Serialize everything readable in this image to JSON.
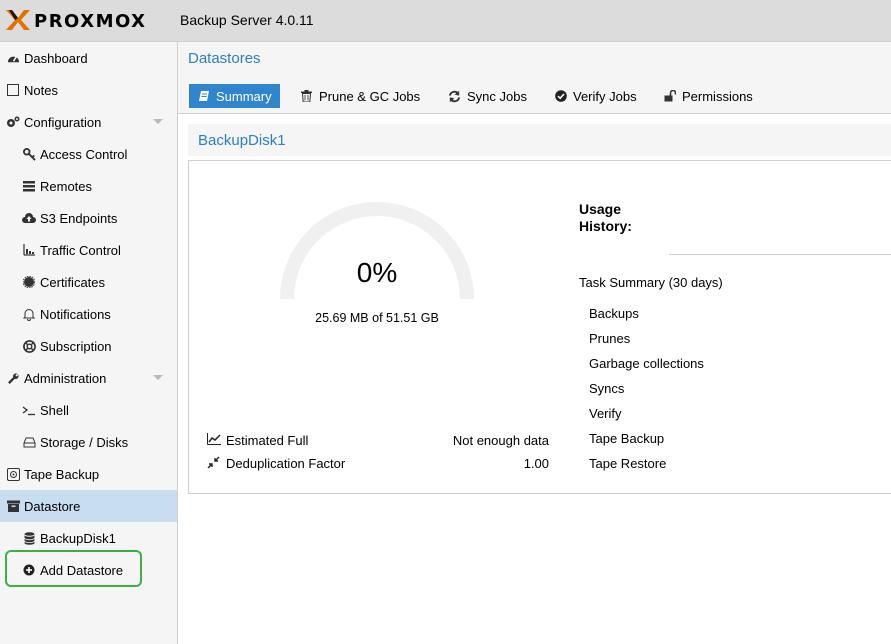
{
  "header": {
    "logo_text": "PROXMOX",
    "app_title": "Backup Server 4.0.11"
  },
  "sidebar": {
    "items": [
      {
        "label": "Dashboard",
        "icon": "dashboard-icon"
      },
      {
        "label": "Notes",
        "icon": "notes-icon"
      },
      {
        "label": "Configuration",
        "icon": "gears-icon"
      },
      {
        "label": "Access Control",
        "icon": "key-icon"
      },
      {
        "label": "Remotes",
        "icon": "server-icon"
      },
      {
        "label": "S3 Endpoints",
        "icon": "cloud-upload-icon"
      },
      {
        "label": "Traffic Control",
        "icon": "chart-bars-icon"
      },
      {
        "label": "Certificates",
        "icon": "certificate-icon"
      },
      {
        "label": "Notifications",
        "icon": "bell-icon"
      },
      {
        "label": "Subscription",
        "icon": "lifebuoy-icon"
      },
      {
        "label": "Administration",
        "icon": "wrench-icon"
      },
      {
        "label": "Shell",
        "icon": "terminal-icon"
      },
      {
        "label": "Storage / Disks",
        "icon": "hdd-icon"
      },
      {
        "label": "Tape Backup",
        "icon": "tape-icon"
      },
      {
        "label": "Datastore",
        "icon": "archive-icon"
      },
      {
        "label": "BackupDisk1",
        "icon": "database-icon"
      },
      {
        "label": "Add Datastore",
        "icon": "plus-circle-icon"
      }
    ]
  },
  "main": {
    "title": "Datastores",
    "tabs": [
      {
        "label": "Summary",
        "icon": "book-icon"
      },
      {
        "label": "Prune & GC Jobs",
        "icon": "trash-icon"
      },
      {
        "label": "Sync Jobs",
        "icon": "refresh-icon"
      },
      {
        "label": "Verify Jobs",
        "icon": "check-circle-icon"
      },
      {
        "label": "Permissions",
        "icon": "unlock-icon"
      }
    ],
    "panel": {
      "title": "BackupDisk1",
      "gauge": {
        "value_text": "0%",
        "fraction": 0.0,
        "usage_text": "25.69 MB of 51.51 GB"
      },
      "stats": [
        {
          "label": "Estimated Full",
          "value": "Not enough data",
          "icon": "line-chart-icon"
        },
        {
          "label": "Deduplication Factor",
          "value": "1.00",
          "icon": "compress-icon"
        }
      ],
      "usage_history_label": "Usage History:",
      "task_summary_title": "Task Summary (30 days)",
      "task_items": [
        "Backups",
        "Prunes",
        "Garbage collections",
        "Syncs",
        "Verify",
        "Tape Backup",
        "Tape Restore"
      ]
    }
  },
  "colors": {
    "accent": "#2f86cf",
    "link": "#2c7fc7",
    "selected_bg": "#c8ddf0",
    "highlight": "#3cb043",
    "logo_orange": "#e57000"
  }
}
